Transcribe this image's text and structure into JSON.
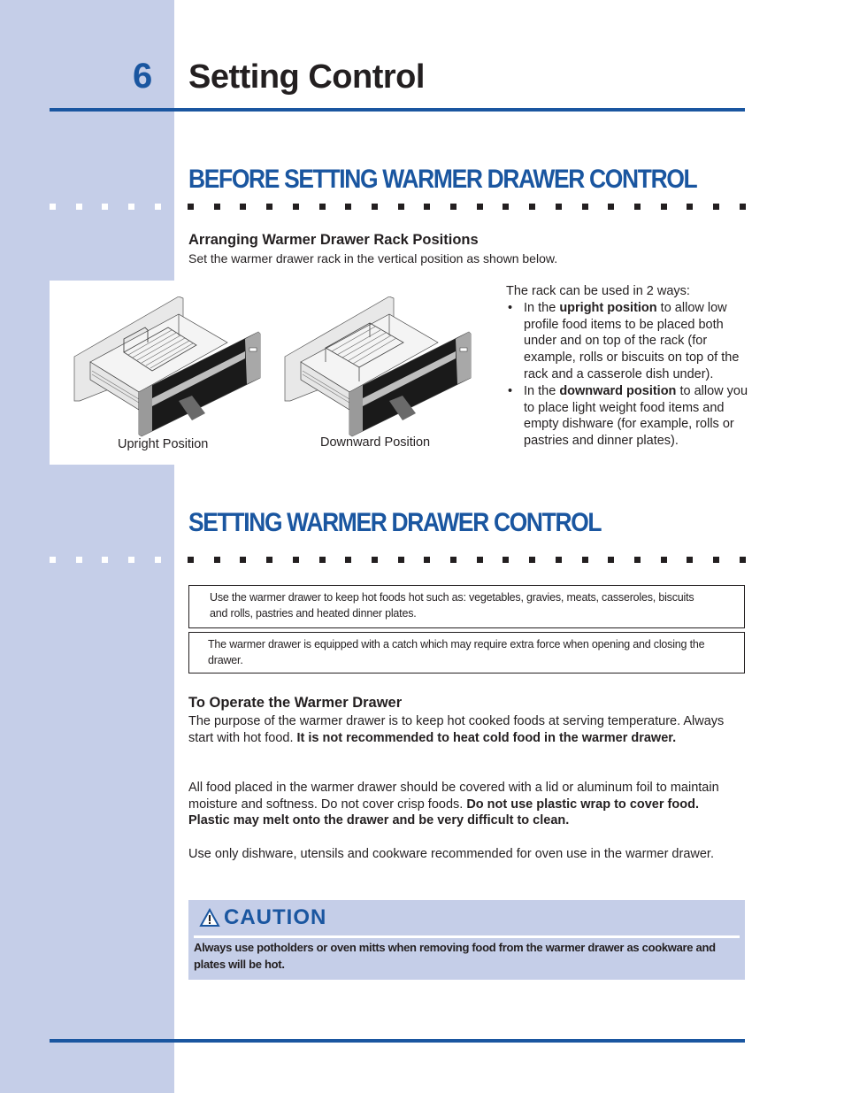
{
  "header": {
    "chapter_number": "6",
    "title": "Setting Control"
  },
  "section1": {
    "heading": "BEFORE SETTING WARMER DRAWER CONTROL",
    "subheading": "Arranging Warmer Drawer Rack Positions",
    "intro": "Set the warmer drawer rack in the vertical position as shown below.",
    "figures": [
      {
        "caption": "Upright Position",
        "icon": "warmer-drawer-upright-rack-illustration"
      },
      {
        "caption": "Downward Position",
        "icon": "warmer-drawer-downward-rack-illustration"
      }
    ],
    "usage": {
      "lead": "The rack can be used in 2 ways:",
      "bullet": "•",
      "items": [
        {
          "prefix": "In the ",
          "bold": "upright position",
          "suffix": " to allow low profile food items to be placed both under and on top of the rack (for example, rolls or biscuits on top of the rack and a casserole dish under)."
        },
        {
          "prefix": "In the ",
          "bold": "downward position",
          "suffix": " to allow you to place light weight food items and empty dishware (for example, rolls or pastries and dinner plates)."
        }
      ]
    }
  },
  "section2": {
    "heading": "SETTING WARMER DRAWER CONTROL",
    "notes": [
      "Use the warmer drawer to keep hot foods hot such as: vegetables, gravies, meats, casseroles, biscuits and rolls, pastries and heated dinner plates.",
      "The warmer drawer is equipped with a catch which may require extra force when opening and closing the drawer."
    ],
    "subheading": "To Operate the Warmer Drawer",
    "paragraphs": [
      {
        "normal": "The purpose of the warmer drawer is to keep hot cooked foods at serving temperature. Always start with hot food. ",
        "bold": "It is not recommended to heat cold food in the warmer drawer."
      },
      {
        "normal": "All food placed in the warmer drawer should be covered with a lid or aluminum foil to maintain moisture and softness. Do not cover crisp foods. ",
        "bold": "Do not use plastic wrap to cover food. Plastic may melt onto the drawer and be very difficult to clean."
      },
      {
        "normal": "Use only dishware, utensils and cookware recommended for oven use in the warmer drawer.",
        "bold": ""
      }
    ]
  },
  "caution": {
    "icon": "warning-triangle-icon",
    "title": "CAUTION",
    "text": "Always use potholders or oven mitts when removing food from the warmer drawer as cookware and plates will be hot."
  },
  "colors": {
    "accent": "#1a56a0",
    "sidebar": "#c5cee8",
    "text": "#231f20"
  }
}
